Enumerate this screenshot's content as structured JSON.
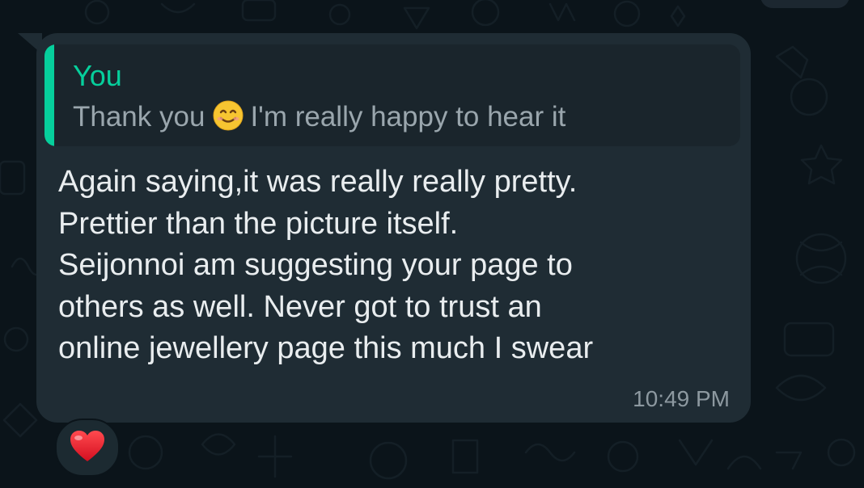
{
  "colors": {
    "background": "#0b141a",
    "bubble": "#1f2c34",
    "quote_accent": "#06cf9c",
    "text_primary": "#e9edef",
    "text_secondary": "#9aa6ad",
    "reaction_heart": "#e8192c"
  },
  "quoted_message": {
    "author": "You",
    "text_before_emoji": "Thank you",
    "emoji": "smiling-face-icon",
    "text_after_emoji": "I'm really happy to hear it"
  },
  "message": {
    "lines": [
      "Again saying,it was really really pretty.",
      "Prettier than the picture itself.",
      "Seijonnoi am suggesting your page to",
      "others as well.  Never got to trust an",
      "online jewellery page this much I swear"
    ],
    "time": "10:49 PM"
  },
  "reaction": {
    "icon": "red-heart-icon"
  }
}
